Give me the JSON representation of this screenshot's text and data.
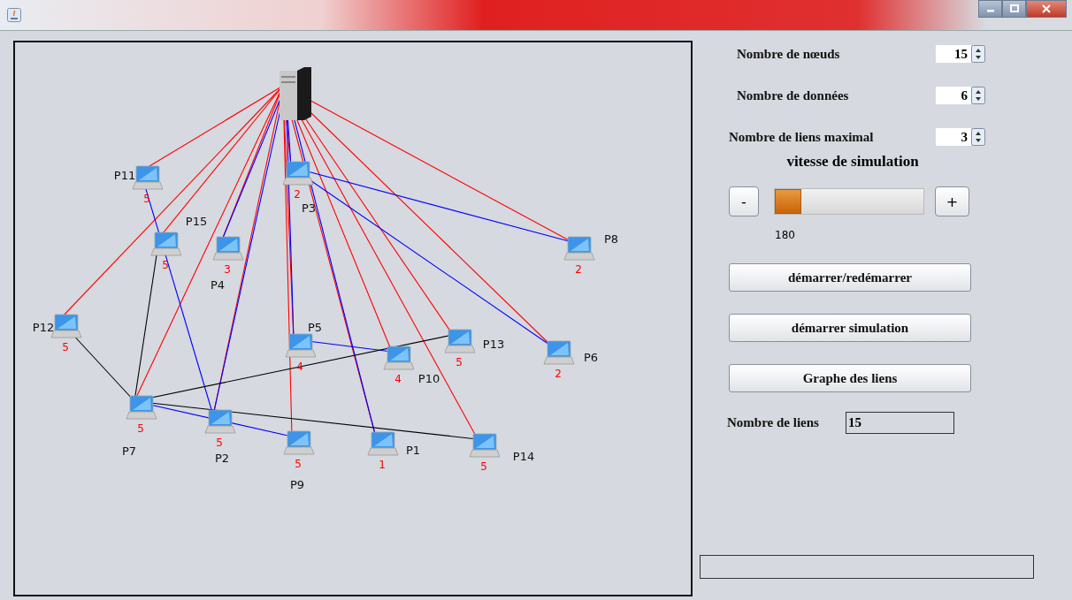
{
  "network": {
    "server": {
      "kind": "server"
    },
    "nodes": [
      {
        "label": "P1",
        "count": "1"
      },
      {
        "label": "P2",
        "count": "5"
      },
      {
        "label": "P3",
        "count": "2"
      },
      {
        "label": "P4",
        "count": "3"
      },
      {
        "label": "P5",
        "count": "4"
      },
      {
        "label": "P6",
        "count": "2"
      },
      {
        "label": "P7",
        "count": "5"
      },
      {
        "label": "P8",
        "count": "2"
      },
      {
        "label": "P9",
        "count": "5"
      },
      {
        "label": "P10",
        "count": "4"
      },
      {
        "label": "P11",
        "count": "5"
      },
      {
        "label": "P12",
        "count": "5"
      },
      {
        "label": "P13",
        "count": "5"
      },
      {
        "label": "P14",
        "count": "5"
      },
      {
        "label": "P15",
        "count": "5"
      }
    ]
  },
  "settings": [
    {
      "label": "Nombre de nœuds",
      "value": "15"
    },
    {
      "label": "Nombre de données",
      "value": "6"
    },
    {
      "label": "Nombre de liens maximal",
      "value": "3"
    }
  ],
  "speed": {
    "title": "vitesse de simulation",
    "minus": "-",
    "plus": "+",
    "level": 0,
    "reading": "180"
  },
  "buttons": [
    "démarrer/redémarrer",
    "démarrer simulation",
    "Graphe des liens"
  ],
  "links": {
    "label": "Nombre de liens",
    "value": "15"
  },
  "progress": {
    "level": 0
  }
}
